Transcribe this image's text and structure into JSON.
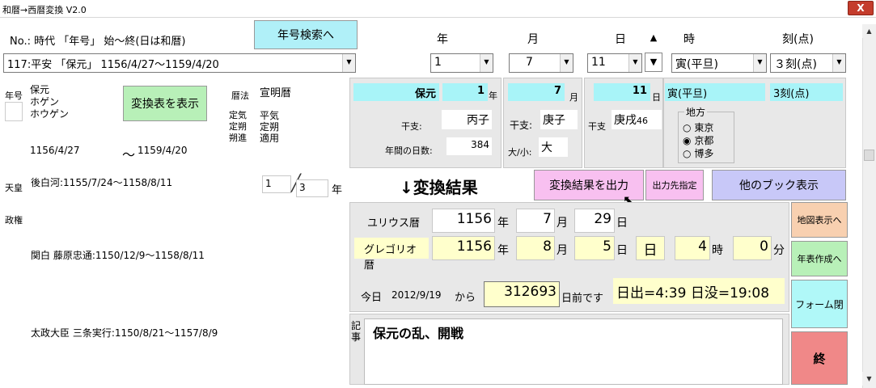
{
  "window": {
    "title": "和暦→西暦変換 V2.0",
    "close_label": "X"
  },
  "header": {
    "col_label": "No.: 時代 「年号」  始〜終(日は和暦)",
    "era_search_button": "年号検索へ",
    "year_label": "年",
    "month_label": "月",
    "day_label": "日",
    "hour_label": "時",
    "koku_label": "刻(点)"
  },
  "selectors": {
    "era": "117:平安 「保元」  1156/4/27〜1159/4/20",
    "year": "1",
    "month": "7",
    "day": "11",
    "hour": "寅(平旦)",
    "koku": "３刻(点)"
  },
  "era_info": {
    "nengo_label": "年号",
    "nengo_text": "保元\nホゲン\nホウゲン",
    "convert_table_button": "変換表を表示",
    "start_date": "1156/4/27",
    "tilde": "〜",
    "end_date": "1159/4/20",
    "rekiho_label": "暦法",
    "rekiho_value": "宣明暦",
    "kiho_labels": "定気\n定朔\n朔進",
    "kiho_values": "平気\n定朔\n適用"
  },
  "emperor": {
    "label": "天皇",
    "value": "後白河:1155/7/24〜1158/8/11",
    "seiken_label": "政権",
    "regent": "関白  藤原忠通:1150/12/9〜1158/8/11",
    "chancellor": "太政大臣 三条実行:1150/8/21〜1157/8/9",
    "page_current": "1",
    "page_total": "3",
    "page_unit": "年"
  },
  "summary": {
    "era_name": "保元",
    "era_year": "1",
    "year_unit": "年",
    "eto_label": "干支:",
    "eto_year": "丙子",
    "days_label": "年間の日数:",
    "days_value": "384",
    "month_value": "7",
    "month_unit": "月",
    "eto_month_label": "干支:",
    "eto_month": "庚子",
    "daisho_label": "大/小:",
    "daisho_value": "大",
    "day_value": "11",
    "day_unit": "日",
    "eto_day_label": "干支",
    "eto_day": "庚戌",
    "eto_day_num": "46",
    "hour_display": "寅(平旦)",
    "koku_display": "3刻(点)"
  },
  "region": {
    "title": "地方",
    "options": [
      "東京",
      "京都",
      "博多"
    ],
    "selected": "京都"
  },
  "results": {
    "heading": "↓変換結果",
    "output_button": "変換結果を出力",
    "output_dest_button": "出力先指定",
    "other_book_button": "他のブック表示",
    "julian_label": "ユリウス暦",
    "julian_year": "1156",
    "julian_month": "7",
    "julian_day": "29",
    "gregorian_label": "グレゴリオ暦",
    "greg_year": "1156",
    "greg_month": "8",
    "greg_day": "5",
    "weekday": "日",
    "greg_hour": "4",
    "greg_min": "0",
    "unit_year": "年",
    "unit_month": "月",
    "unit_day": "日",
    "unit_hour": "時",
    "unit_min": "分",
    "today_label": "今日",
    "today_date": "2012/9/19",
    "from_label": "から",
    "days_before": "312693",
    "days_before_label": "日前です",
    "sun": "日出=4:39 日没=19:08"
  },
  "notes": {
    "label": "記事",
    "text": "保元の乱、開戦"
  },
  "side_buttons": {
    "map": "地図表示へ",
    "chronology": "年表作成へ",
    "close_form": "フォーム閉",
    "end": "終"
  },
  "colors": {
    "cyan": "#a8f4f8",
    "green": "#b8f0b8",
    "pink": "#f8c0f0",
    "purple": "#c8c8f8",
    "orange": "#f8d0b0",
    "lightcyan": "#b0f8f8",
    "red": "#f08888",
    "yellow": "#ffffcc"
  }
}
